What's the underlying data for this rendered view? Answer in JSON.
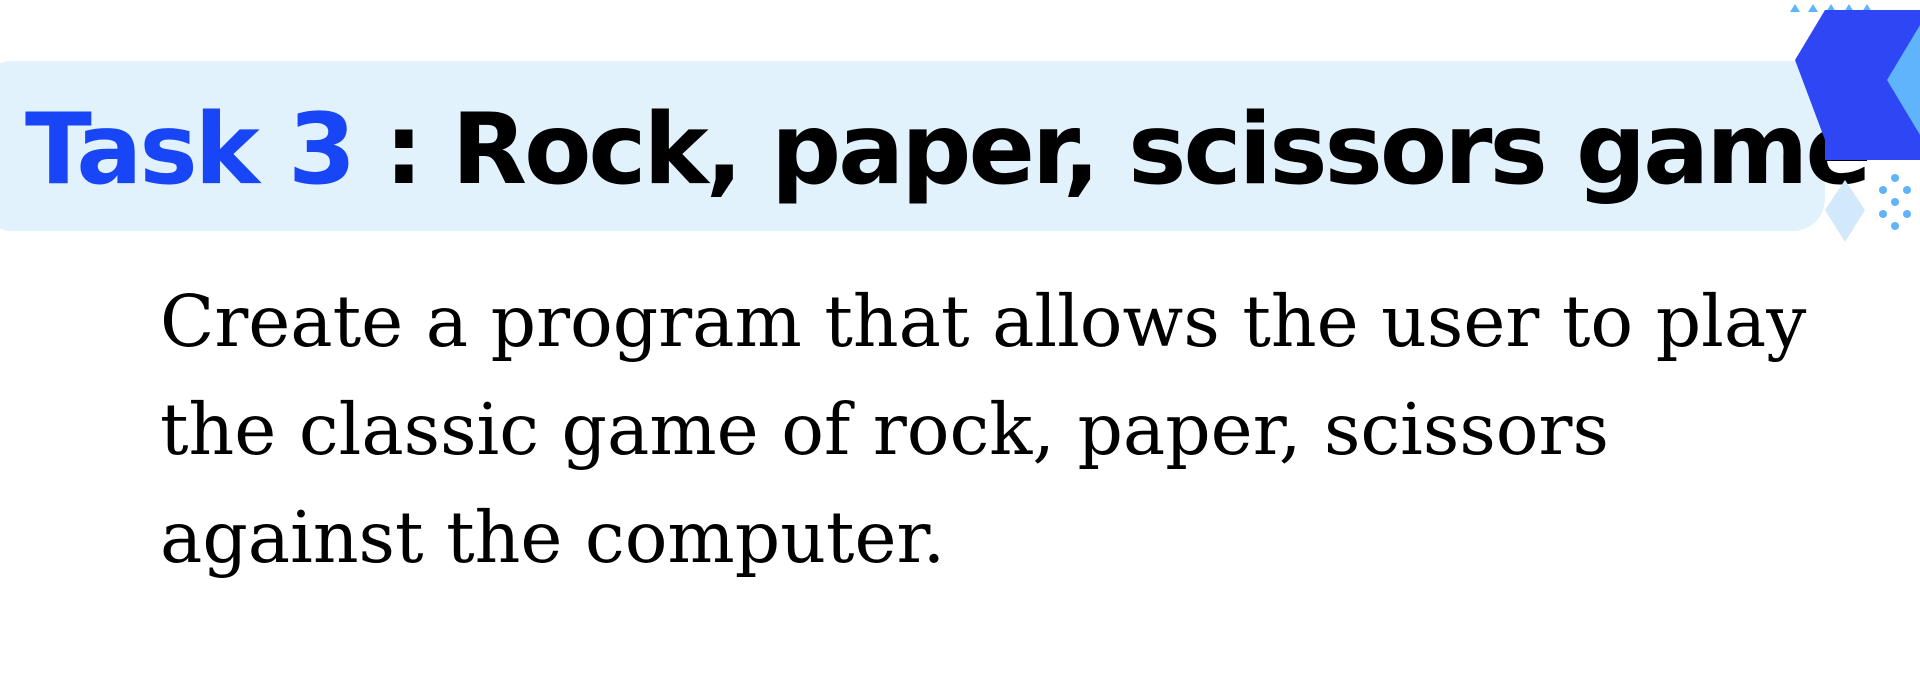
{
  "heading": {
    "task_label": "Task 3",
    "separator": " : ",
    "title": "Rock, paper, scissors game"
  },
  "description": {
    "lines": [
      "Create a program that allows the user to play",
      "the classic game of rock, paper, scissors",
      "against the computer."
    ]
  },
  "colors": {
    "accent_blue": "#1845f5",
    "banner_background": "#e1f2fc",
    "decoration_blue": "#2f46f5",
    "decoration_light_blue": "#5fb4fb"
  }
}
